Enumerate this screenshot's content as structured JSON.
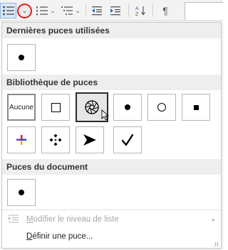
{
  "ribbon": {
    "buttons": [
      "bullets",
      "bullets-dropdown",
      "numbering",
      "multilevel-list",
      "decrease-indent",
      "increase-indent",
      "sort",
      "show-formatting"
    ]
  },
  "menu": {
    "recent_header": "Dernières puces utilisées",
    "library_header": "Bibliothèque de puces",
    "document_header": "Puces du document",
    "none_label": "Aucune",
    "change_level_prefix": "M",
    "change_level_rest": "odifier le niveau de liste",
    "define_prefix": "D",
    "define_rest": "éfinir une puce..."
  },
  "library": {
    "row1": [
      "none",
      "hollow-square",
      "aperture",
      "filled-circle",
      "hollow-circle",
      "filled-square"
    ],
    "row2": [
      "color-plus",
      "four-diamond",
      "arrowhead",
      "checkmark"
    ]
  },
  "colors": {
    "hover_border": "#2b2b2b",
    "annotation_circle": "#e01e1e",
    "section_bg": "#eeeeee"
  }
}
